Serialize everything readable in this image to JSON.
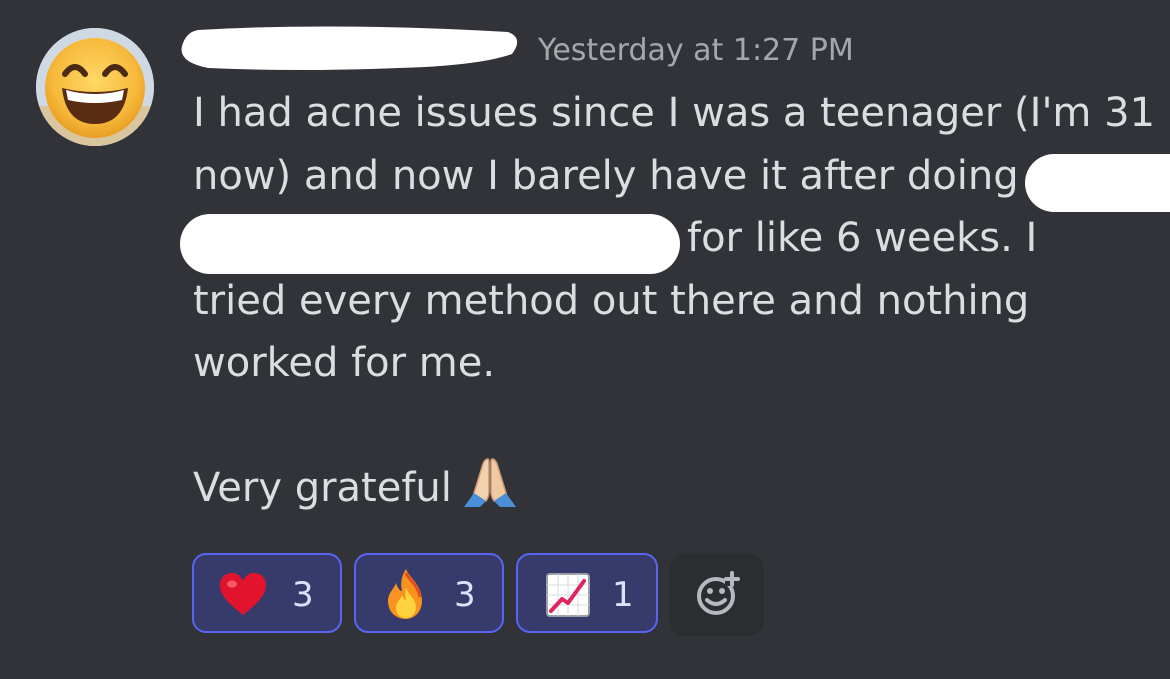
{
  "message": {
    "timestamp": "Yesterday at 1:27 PM",
    "lines": [
      "I had acne issues since I was a teenager (I'm 31",
      "now) and now I barely have it after doing",
      "for like 6 weeks. I",
      "tried every method out there and nothing",
      "worked for me."
    ],
    "closing": "Very grateful"
  },
  "reactions": [
    {
      "emoji": "red-heart",
      "count": "3"
    },
    {
      "emoji": "fire",
      "count": "3"
    },
    {
      "emoji": "chart-increasing",
      "count": "1"
    }
  ],
  "icons": {
    "avatar": "grinning-face-avatar",
    "closing_emoji": "folded-hands",
    "add_reaction": "add-reaction-smiley-icon"
  },
  "colors": {
    "background": "#313338",
    "text": "#dbdee1",
    "timestamp": "#a5a7ac",
    "reaction_border": "#5865f2",
    "reaction_bg": "#373b6b"
  }
}
